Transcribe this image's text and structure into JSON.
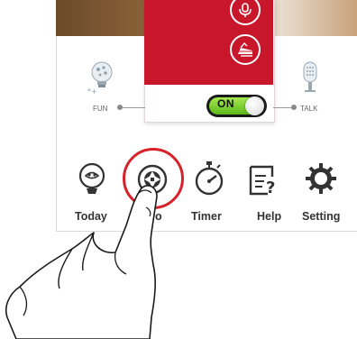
{
  "toggle": {
    "label": "ON",
    "state": "on"
  },
  "sides": {
    "left_label": "FUN",
    "right_label": "TALK"
  },
  "nav": [
    {
      "id": "today",
      "label": "Today",
      "icon": "sun-face-icon"
    },
    {
      "id": "photo",
      "label": "o",
      "icon": "camera-shutter-icon"
    },
    {
      "id": "timer",
      "label": "Timer",
      "icon": "stopwatch-icon"
    },
    {
      "id": "help",
      "label": "Help",
      "icon": "help-note-icon"
    },
    {
      "id": "setting",
      "label": "Setting",
      "icon": "gear-icon"
    }
  ],
  "colors": {
    "accent_red": "#c8162b",
    "highlight_ring": "#d8222b",
    "toggle_green": "#7fd431"
  }
}
